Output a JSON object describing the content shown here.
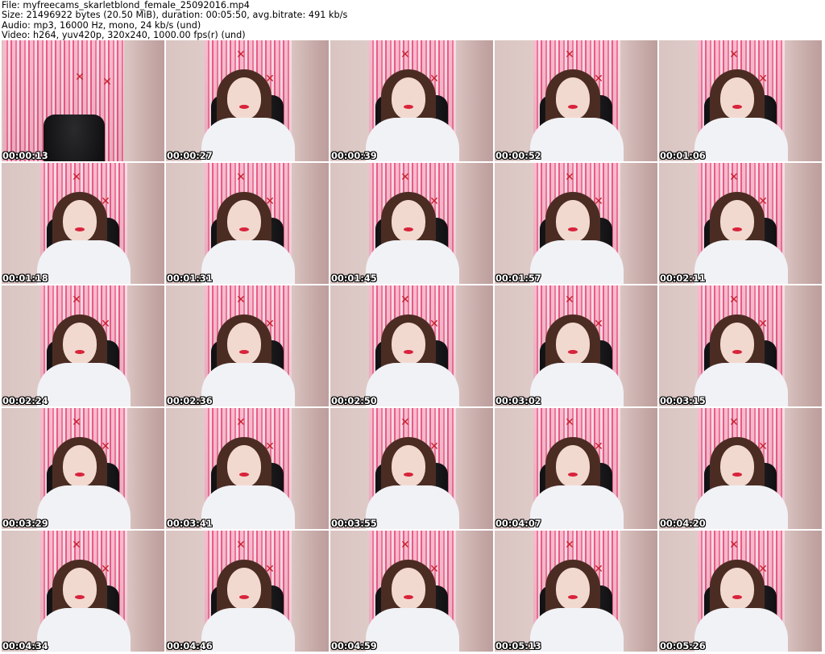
{
  "header": {
    "file": "File: myfreecams_skarletblond_female_25092016.mp4",
    "size": "Size: 21496922 bytes (20.50 MiB), duration: 00:05:50, avg.bitrate: 491 kb/s",
    "audio": "Audio: mp3, 16000 Hz, mono, 24 kb/s (und)",
    "video": "Video: h264, yuv420p, 320x240, 1000.00 fps(r) (und)"
  },
  "colors": {
    "curtain": "#ee6f95",
    "wall": "#dccac7",
    "hair": "#4b2c22",
    "shirt": "#f1f2f6",
    "chair": "#111113",
    "bow": "#c8202e"
  },
  "thumbnails": [
    {
      "timestamp": "00:00:13",
      "person": false
    },
    {
      "timestamp": "00:00:27",
      "person": true
    },
    {
      "timestamp": "00:00:39",
      "person": true
    },
    {
      "timestamp": "00:00:52",
      "person": true
    },
    {
      "timestamp": "00:01:06",
      "person": true
    },
    {
      "timestamp": "00:01:18",
      "person": true
    },
    {
      "timestamp": "00:01:31",
      "person": true
    },
    {
      "timestamp": "00:01:45",
      "person": true
    },
    {
      "timestamp": "00:01:57",
      "person": true
    },
    {
      "timestamp": "00:02:11",
      "person": true
    },
    {
      "timestamp": "00:02:24",
      "person": true
    },
    {
      "timestamp": "00:02:36",
      "person": true
    },
    {
      "timestamp": "00:02:50",
      "person": true
    },
    {
      "timestamp": "00:03:02",
      "person": true
    },
    {
      "timestamp": "00:03:15",
      "person": true
    },
    {
      "timestamp": "00:03:29",
      "person": true
    },
    {
      "timestamp": "00:03:41",
      "person": true
    },
    {
      "timestamp": "00:03:55",
      "person": true
    },
    {
      "timestamp": "00:04:07",
      "person": true
    },
    {
      "timestamp": "00:04:20",
      "person": true
    },
    {
      "timestamp": "00:04:34",
      "person": true
    },
    {
      "timestamp": "00:04:46",
      "person": true
    },
    {
      "timestamp": "00:04:59",
      "person": true
    },
    {
      "timestamp": "00:05:13",
      "person": true
    },
    {
      "timestamp": "00:05:26",
      "person": true
    }
  ]
}
